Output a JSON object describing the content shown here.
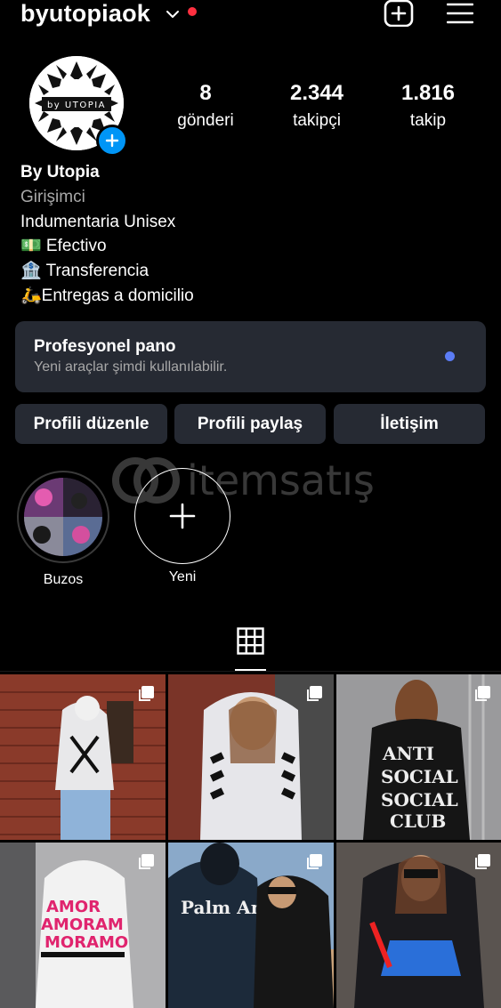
{
  "header": {
    "username": "byutopiaok",
    "icons": [
      "chevron-down-icon",
      "notification-dot-icon",
      "add-post-icon",
      "menu-icon"
    ]
  },
  "profile": {
    "avatar_text": "by UTOPIA",
    "stats": [
      {
        "number": "8",
        "label": "gönderi"
      },
      {
        "number": "2.344",
        "label": "takipçi"
      },
      {
        "number": "1.816",
        "label": "takip"
      }
    ],
    "bio": {
      "name": "By Utopia",
      "category": "Girişimci",
      "lines": [
        "Indumentaria Unisex",
        "💵 Efectivo",
        "🏦 Transferencia",
        "🛵Entregas a domicilio"
      ]
    }
  },
  "pro_panel": {
    "title": "Profesyonel pano",
    "subtitle": "Yeni araçlar şimdi kullanılabilir."
  },
  "buttons": {
    "edit": "Profili düzenle",
    "share": "Profili paylaş",
    "contact": "İletişim"
  },
  "highlights": [
    {
      "label": "Buzos"
    },
    {
      "label": "Yeni"
    }
  ],
  "watermark": "itemsatış",
  "tabs": {
    "active": "grid-icon"
  },
  "colors": {
    "background": "#000000",
    "panel": "#262a33",
    "accent_blue": "#0095f6",
    "notification_red": "#ff3040",
    "indicator_blue": "#5b7cf5"
  },
  "posts": [
    {
      "description": "white-hoodie-brick-wall"
    },
    {
      "description": "white-hoodie-striped-sleeves"
    },
    {
      "description": "black-hoodie-anti-social-club"
    },
    {
      "description": "white-hoodie-pink-graffiti"
    },
    {
      "description": "black-hoodie-palm-angels"
    },
    {
      "description": "black-hoodie-blue-graphic"
    }
  ]
}
